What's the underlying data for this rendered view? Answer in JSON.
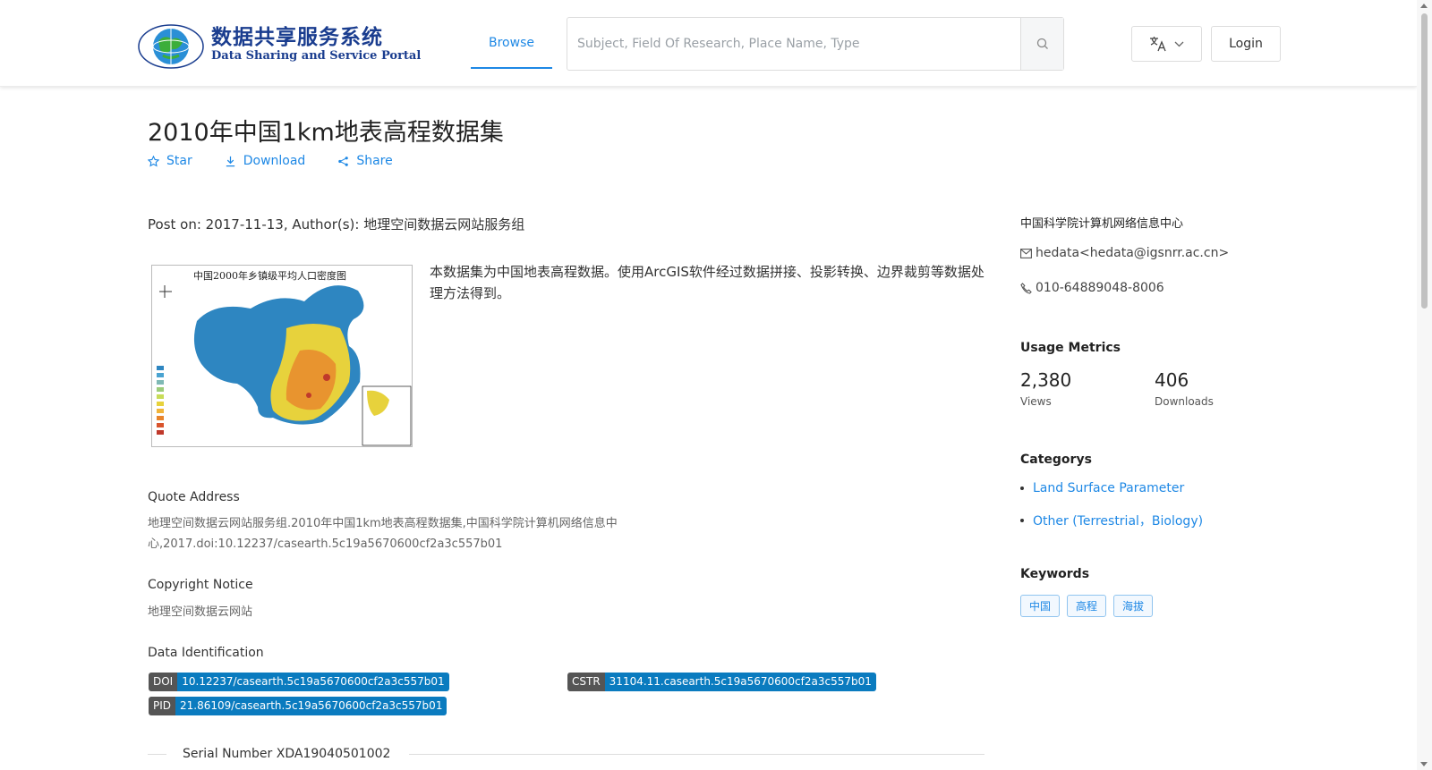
{
  "header": {
    "logo_cn": "数据共享服务系统",
    "logo_en": "Data Sharing and Service Portal",
    "nav_browse": "Browse",
    "search_placeholder": "Subject, Field Of Research, Place Name, Type",
    "search_value": "",
    "login": "Login"
  },
  "dataset": {
    "title": "2010年中国1km地表高程数据集",
    "actions": {
      "star": "Star",
      "download": "Download",
      "share": "Share"
    },
    "post_on": "Post on: 2017-11-13, Author(s): 地理空间数据云网站服务组",
    "thumb_title": "中国2000年乡镇级平均人口密度图",
    "description": "本数据集为中国地表高程数据。使用ArcGIS软件经过数据拼接、投影转换、边界裁剪等数据处理方法得到。",
    "quote_label": "Quote Address",
    "quote_text": "地理空间数据云网站服务组.2010年中国1km地表高程数据集,中国科学院计算机网络信息中心,2017.doi:10.12237/casearth.5c19a5670600cf2a3c557b01",
    "copyright_label": "Copyright Notice",
    "copyright_text": "地理空间数据云网站",
    "ident_label": "Data Identification",
    "doi_key": "DOI",
    "doi_val": "10.12237/casearth.5c19a5670600cf2a3c557b01",
    "cstr_key": "CSTR",
    "cstr_val": "31104.11.casearth.5c19a5670600cf2a3c557b01",
    "pid_key": "PID",
    "pid_val": "21.86109/casearth.5c19a5670600cf2a3c557b01",
    "serial": "Serial Number XDA19040501002"
  },
  "sidebar": {
    "org": "中国科学院计算机网络信息中心",
    "email": "hedata<hedata@igsnrr.ac.cn>",
    "phone": "010-64889048-8006",
    "usage_heading": "Usage Metrics",
    "views_count": "2,380",
    "views_label": "Views",
    "downloads_count": "406",
    "downloads_label": "Downloads",
    "categories_heading": "Categorys",
    "categories": [
      "Land Surface Parameter",
      "Other (Terrestrial，Biology)"
    ],
    "keywords_heading": "Keywords",
    "keywords": [
      "中国",
      "高程",
      "海拔"
    ]
  },
  "colors": {
    "accent": "#1e88e5",
    "badge_value": "#0a7bbf",
    "badge_key": "#555555"
  }
}
